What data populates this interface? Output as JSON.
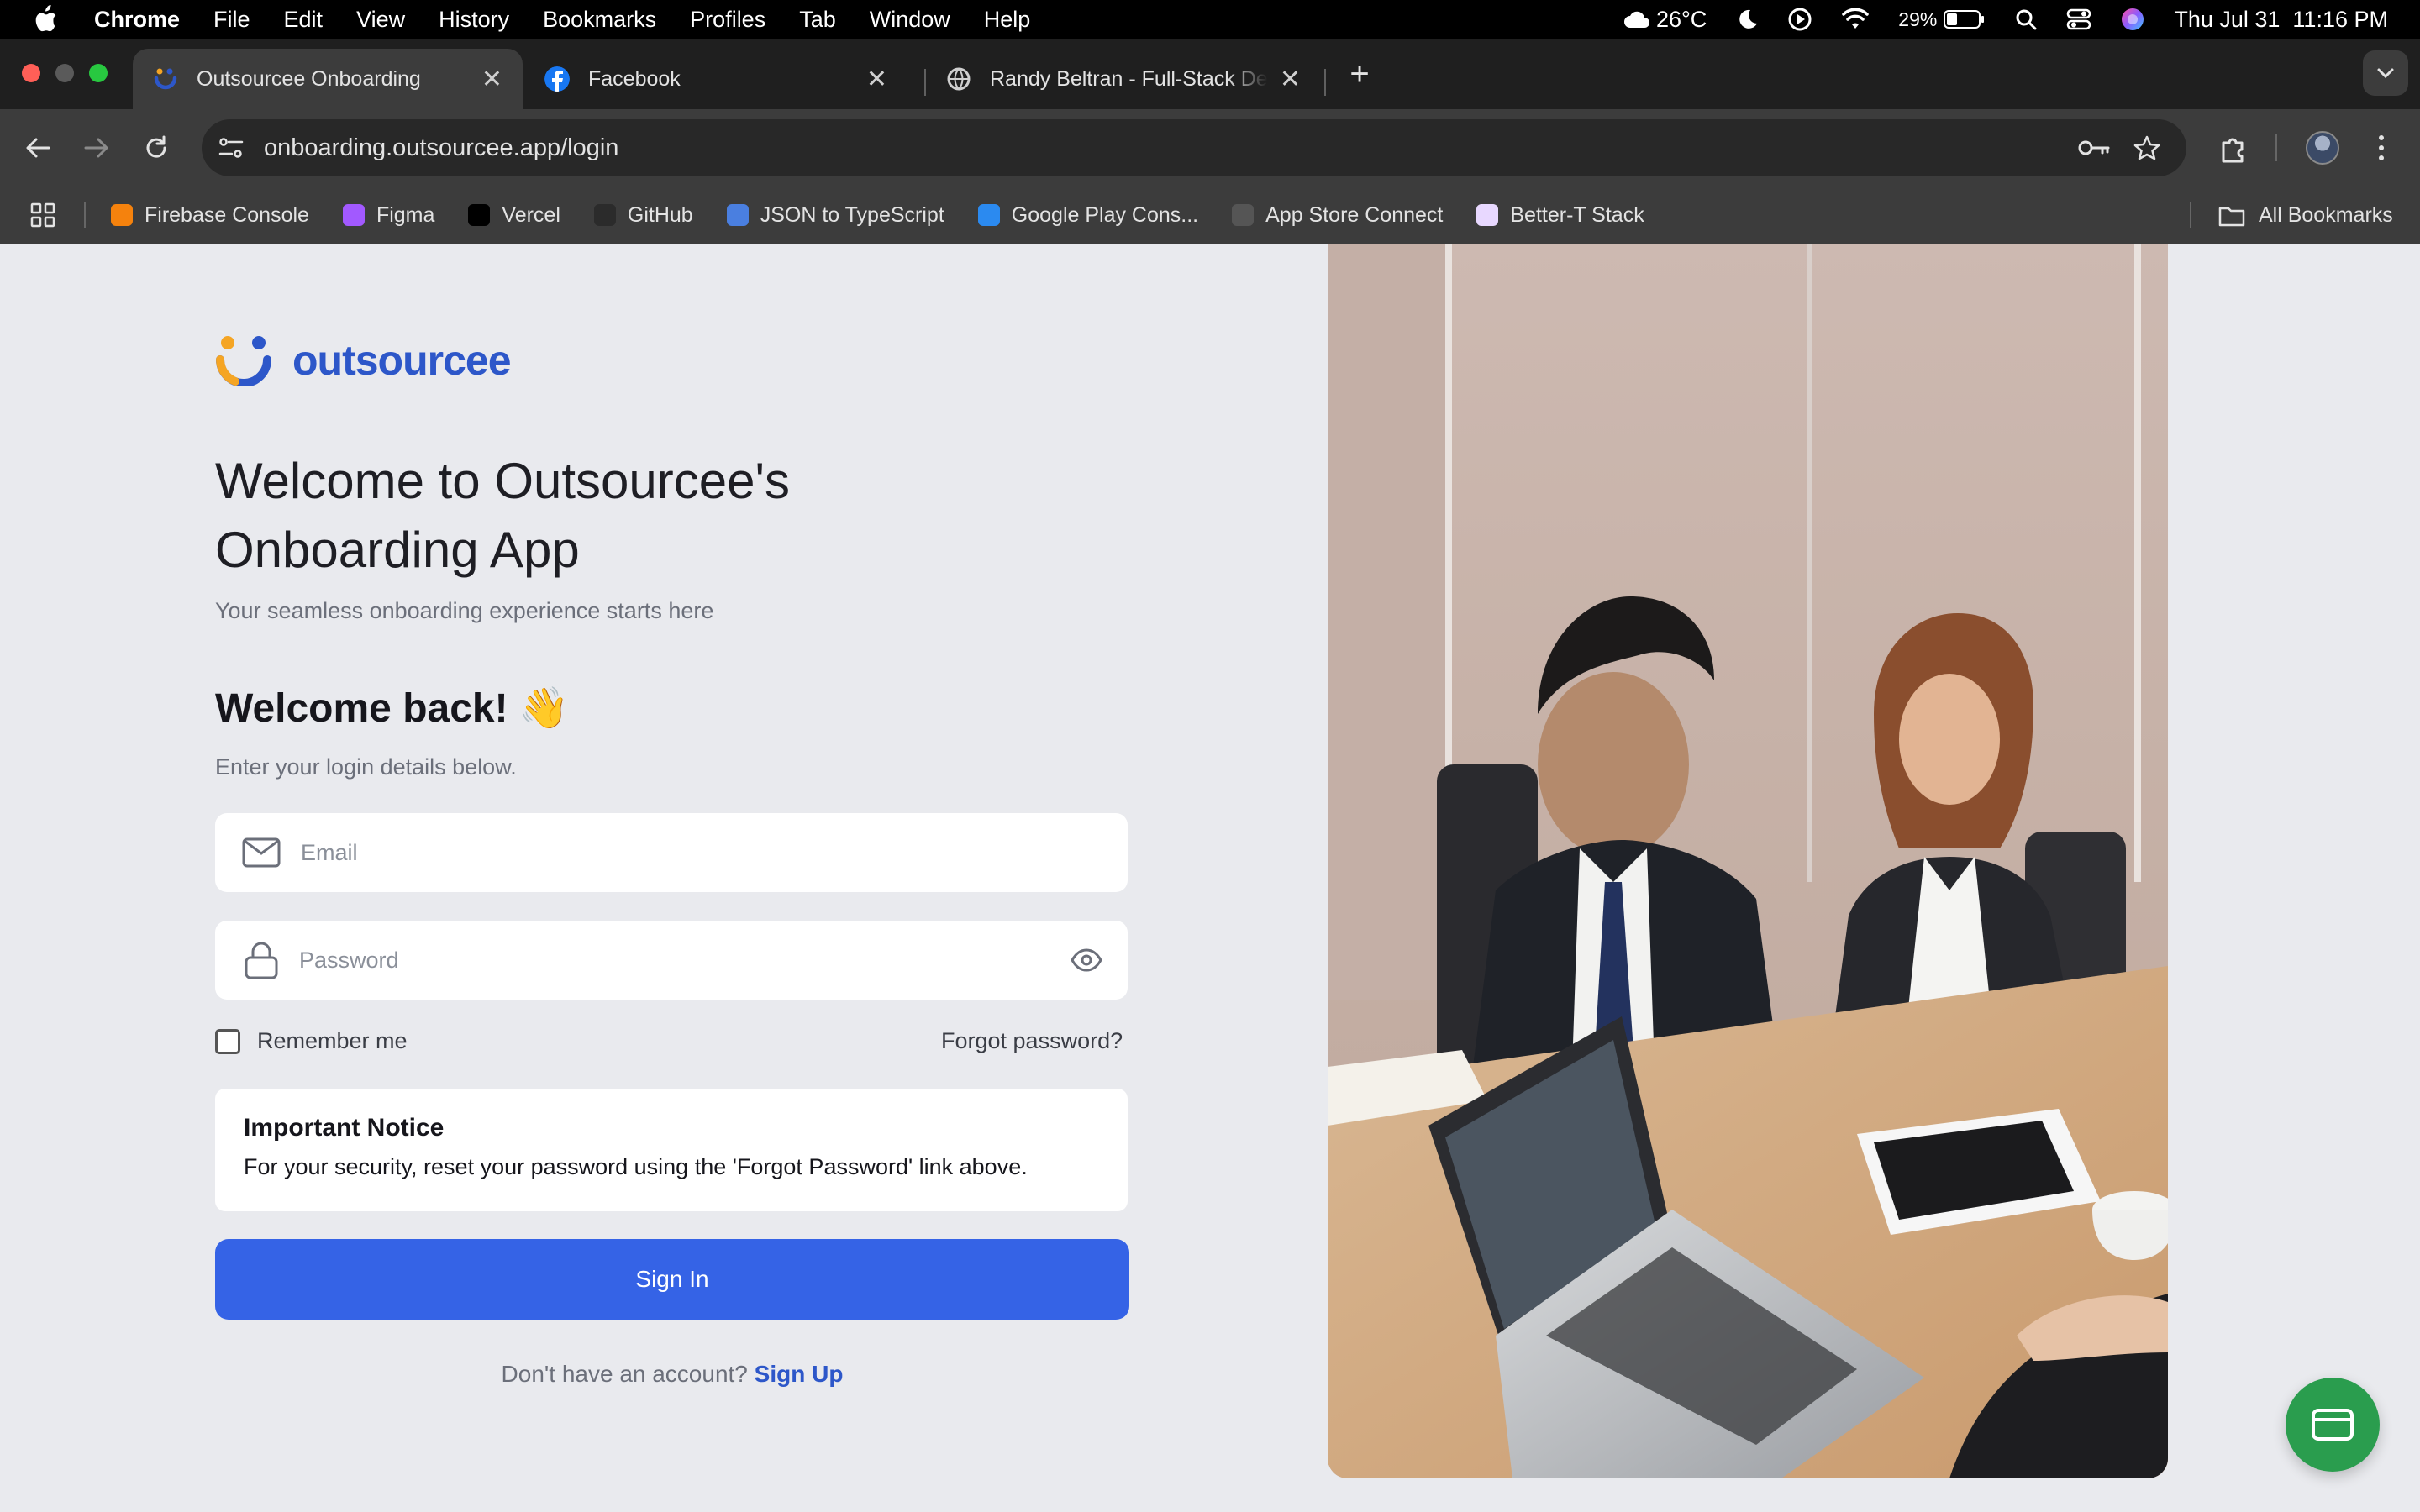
{
  "menubar": {
    "app": "Chrome",
    "menus": [
      "File",
      "Edit",
      "View",
      "History",
      "Bookmarks",
      "Profiles",
      "Tab",
      "Window",
      "Help"
    ],
    "weather": "26°C",
    "battery": "29%",
    "datetime": "Thu Jul 31  11:16 PM"
  },
  "tabs": [
    {
      "title": "Outsourcee Onboarding",
      "icon": "outsourcee-favicon",
      "active": true
    },
    {
      "title": "Facebook",
      "icon": "facebook-favicon",
      "active": false
    },
    {
      "title": "Randy Beltran - Full-Stack De",
      "icon": "globe-favicon",
      "active": false
    }
  ],
  "address_bar": {
    "url": "onboarding.outsourcee.app/login"
  },
  "bookmarks": [
    {
      "label": "Firebase Console",
      "icon": "firebase-icon",
      "color": "#f5820d"
    },
    {
      "label": "Figma",
      "icon": "figma-icon",
      "color": "#a259ff"
    },
    {
      "label": "Vercel",
      "icon": "vercel-icon",
      "color": "#000000"
    },
    {
      "label": "GitHub",
      "icon": "github-icon",
      "color": "#2b2b2b"
    },
    {
      "label": "JSON to TypeScript",
      "icon": "json-icon",
      "color": "#4a7fe0"
    },
    {
      "label": "Google Play Cons...",
      "icon": "google-play-icon",
      "color": "#2b8af0"
    },
    {
      "label": "App Store Connect",
      "icon": "apple-icon",
      "color": "#555555"
    },
    {
      "label": "Better-T Stack",
      "icon": "terminal-icon",
      "color": "#e8d8ff"
    }
  ],
  "all_bookmarks_label": "All Bookmarks",
  "login": {
    "brand": "outsourcee",
    "heading": "Welcome to Outsourcee's Onboarding App",
    "subheading": "Your seamless onboarding experience starts here",
    "welcome": "Welcome back! 👋",
    "hint": "Enter your login details below.",
    "email_placeholder": "Email",
    "password_placeholder": "Password",
    "remember_me": "Remember me",
    "forgot_password": "Forgot password?",
    "notice_title": "Important Notice",
    "notice_body": "For your security, reset your password using the 'Forgot Password' link above.",
    "sign_in": "Sign In",
    "no_account": "Don't have an account?",
    "sign_up": "Sign Up"
  },
  "colors": {
    "primary": "#3563e6",
    "brand_blue": "#2d57c9",
    "fab_green": "#2a9d4e"
  }
}
